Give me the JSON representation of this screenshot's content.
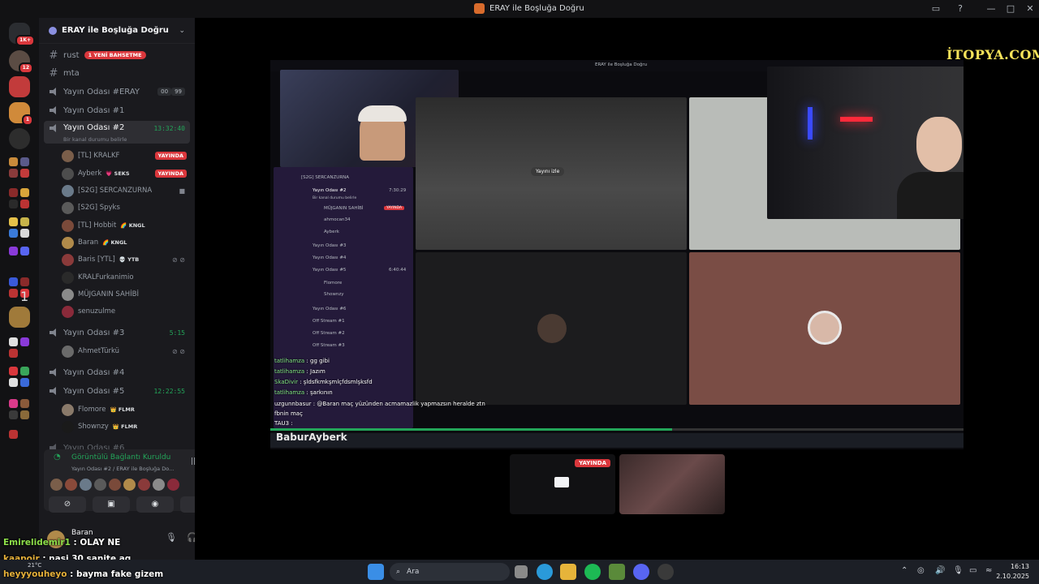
{
  "window": {
    "title": "ERAY ile Boşluğa Doğru"
  },
  "servers": {
    "top_badge": "1K+",
    "badge_12": "12",
    "badge_1a": "1",
    "badge_1b": "1"
  },
  "guild": {
    "name": "ERAY ile Boşluğa Doğru"
  },
  "channels": [
    {
      "type": "text",
      "name": "rust",
      "pill": "1 YENİ BAHSETME"
    },
    {
      "type": "text",
      "name": "mta"
    },
    {
      "type": "voice",
      "name": "Yayın Odası #ERAY",
      "count_a": "00",
      "count_b": "99"
    },
    {
      "type": "voice",
      "name": "Yayın Odası #1"
    },
    {
      "type": "voice",
      "name": "Yayın Odası #2",
      "duration": "13:32:40",
      "subtitle": "Bir kanal durumu belirle"
    },
    {
      "type": "voice",
      "name": "Yayın Odası #3",
      "duration": "5:15"
    },
    {
      "type": "voice",
      "name": "Yayın Odası #4"
    },
    {
      "type": "voice",
      "name": "Yayın Odası #5",
      "duration": "12:22:55"
    },
    {
      "type": "voice",
      "name": "Yayın Odası #6"
    }
  ],
  "room2_members": [
    {
      "name": "[TL] KRALKF",
      "live": "YAYINDA"
    },
    {
      "name": "Ayberk",
      "tag": "💗 SEKS",
      "live": "YAYINDA"
    },
    {
      "name": "[S2G] SERCANZURNA"
    },
    {
      "name": "[S2G] Spyks"
    },
    {
      "name": "[TL] Hobbit",
      "tag": "🌈 KNGL"
    },
    {
      "name": "Baran",
      "tag": "🌈 KNGL"
    },
    {
      "name": "Baris [YTL]",
      "tag": "💀 YTB"
    },
    {
      "name": "KRALFurkanimio"
    },
    {
      "name": "MÜJGANIN SAHİBİ"
    },
    {
      "name": "senuzulme"
    }
  ],
  "room3_members": [
    {
      "name": "AhmetTürkü"
    }
  ],
  "room5_members": [
    {
      "name": "Flomore",
      "tag": "👑 FLMR"
    },
    {
      "name": "Shownzy",
      "tag": "👑 FLMR"
    }
  ],
  "voice_panel": {
    "status": "Görüntülü Bağlantı Kuruldu",
    "location": "Yayın Odası #2 / ERAY ile Boşluğa Do..."
  },
  "user_panel": {
    "name": "Baran"
  },
  "stream": {
    "inner_title": "ERAY ile Boşluğa Doğru",
    "watch_label": "Yayını izle",
    "sponsor": "İTOPYA.COM",
    "watermark": "BaburAyberk",
    "tile_live": "YAYINDA",
    "inner_channels": [
      "[S2G] SERCANZURNA",
      "Yayın Odası #2",
      "Bir kanal durumu belirle",
      "MÜJGANIN SAHİBİ",
      "ahmocan34",
      "Ayberk",
      "Yayın Odası #3",
      "Yayın Odası #4",
      "Yayın Odası #5",
      "Flomore",
      "Shownzy",
      "Yayın Odası #6",
      "Off Stream #1",
      "Off Stream #2",
      "Off Stream #3"
    ],
    "inner_time_2": "7:30:29",
    "inner_time_5": "6:40:44",
    "inner_live": "YAYINDA",
    "chat": [
      {
        "name": "tatlihamza",
        "text": ": gg gibi"
      },
      {
        "name": "tatlihamza",
        "text": ": Jazım"
      },
      {
        "name": "SkaDivir",
        "text": ": şldsfkmkşmlçfdsmlşksfd"
      },
      {
        "name": "tatlihamza",
        "text": ": şarkının"
      },
      {
        "name": "uzgunnbasur",
        "text": ": @Baran maç yüzünden acmamazlik yapmazsın heralde ztn"
      },
      {
        "name": "fbnin",
        "text": "maç"
      },
      {
        "name": "TAU3",
        "text": ":"
      }
    ]
  },
  "overlay_chat": [
    {
      "name": "Emirelidemir1",
      "text": ": OLAY NE"
    },
    {
      "name": "kaapoir",
      "text": ": nasi 30 sanite aq"
    },
    {
      "name": "heyyyouheyo",
      "text": ": bayma fake gizem"
    }
  ],
  "taskbar": {
    "search_placeholder": "Ara",
    "time": "16:13",
    "date": "2.10.2025",
    "weather": "21°C"
  }
}
